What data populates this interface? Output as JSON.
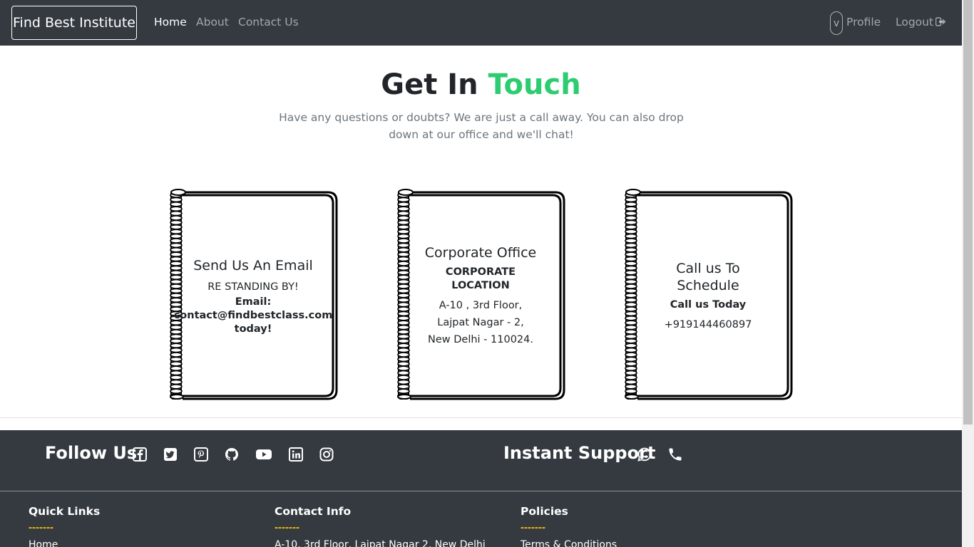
{
  "nav": {
    "brand": "Find Best Institute",
    "links": [
      "Home",
      "About",
      "Contact Us"
    ],
    "avatar_initial": "v",
    "profile": "Profile",
    "logout": "Logout"
  },
  "hero": {
    "title_main": "Get In ",
    "title_accent": "Touch",
    "subtitle": "Have any questions or doubts? We are just a call away. You can also drop down at our office and we'll chat!"
  },
  "cards": [
    {
      "title": "Send Us An Email",
      "line1": "RE STANDING BY!",
      "bold_lines": [
        "Email:",
        "contact@findbestclass.com",
        "today!"
      ]
    },
    {
      "title": "Corporate Office",
      "subtitle": "CORPORATE LOCATION",
      "lines": [
        "A-10 , 3rd Floor,",
        "Lajpat Nagar - 2,",
        "New Delhi - 110024."
      ]
    },
    {
      "title": "Call us To Schedule",
      "subtitle": "Call us Today",
      "lines": [
        "+919144460897"
      ]
    }
  ],
  "footer": {
    "follow": "Follow Us",
    "social_icons": [
      "facebook-icon",
      "twitter-icon",
      "pinterest-icon",
      "github-icon",
      "youtube-icon",
      "linkedin-icon",
      "instagram-icon"
    ],
    "support": "Instant Support",
    "support_icons": [
      "whatsapp-icon",
      "phone-icon"
    ],
    "columns": [
      {
        "title": "Quick Links",
        "dash": "-------",
        "first_item": "Home"
      },
      {
        "title": "Contact Info",
        "dash": "-------",
        "first_item": "A-10, 3rd Floor, Lajpat Nagar 2, New Delhi"
      },
      {
        "title": "Policies",
        "dash": "-------",
        "first_item": "Terms & Conditions"
      }
    ]
  },
  "colors": {
    "navbar": "#343a40",
    "accent_green": "#2ecc71",
    "dash_yellow": "#ffc107"
  }
}
